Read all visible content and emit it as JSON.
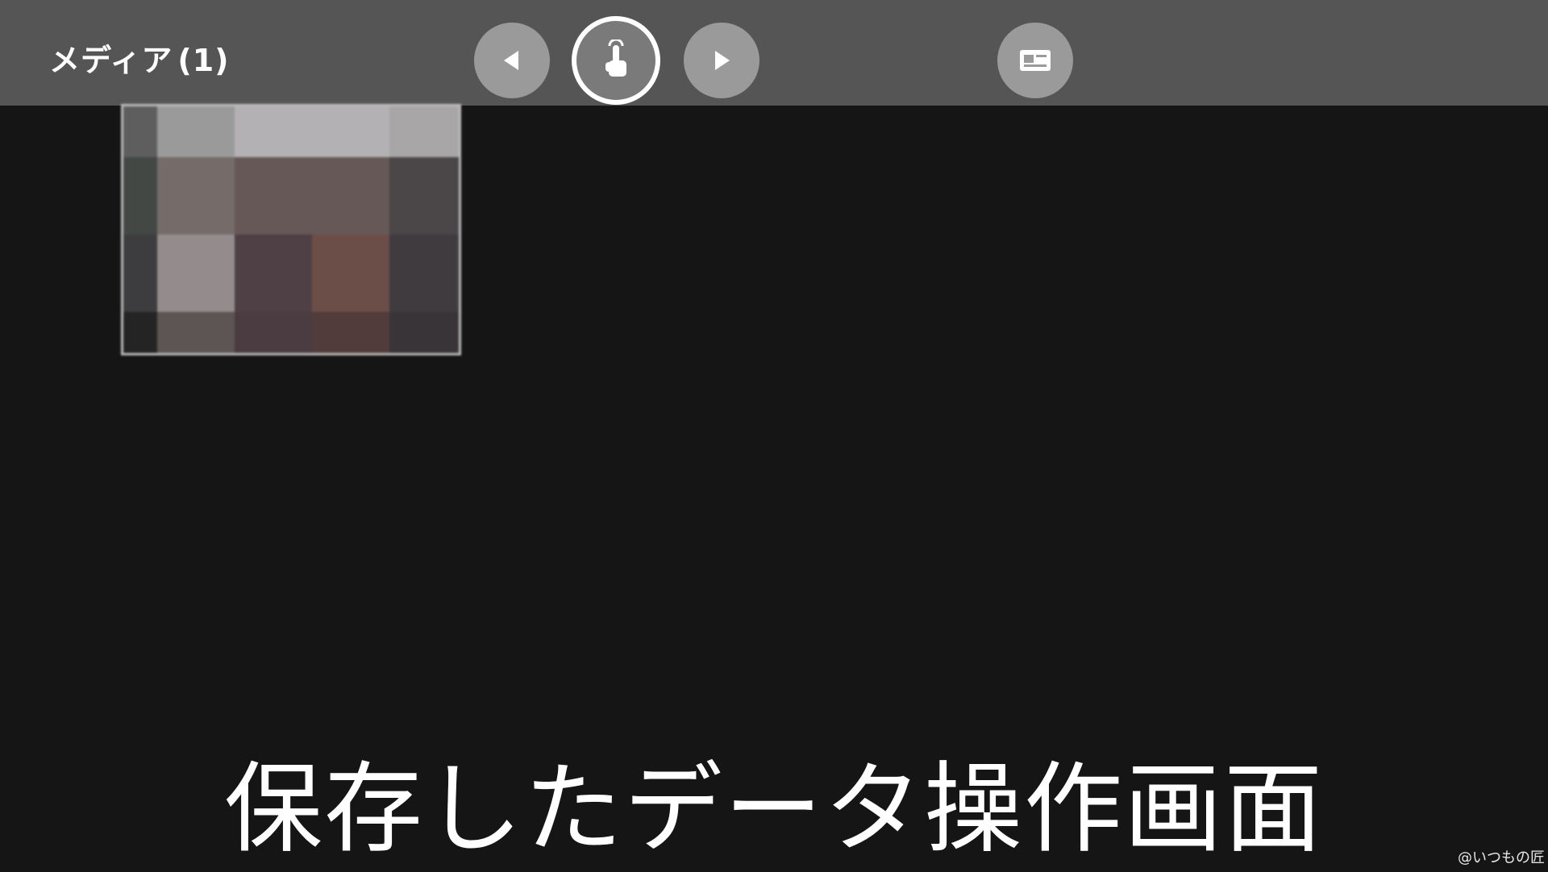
{
  "header": {
    "title": "メディア",
    "count": "(1)"
  },
  "controls": {
    "prev_icon": "triangle-left-icon",
    "select_icon": "hand-pointer-icon",
    "next_icon": "triangle-right-icon",
    "view_icon": "card-view-icon"
  },
  "media": {
    "items": [
      {
        "kind": "pixelated-thumbnail"
      }
    ]
  },
  "caption": {
    "text": "保存したデータ操作画面"
  },
  "watermark": {
    "text": "@いつもの匠"
  },
  "colors": {
    "topbar": "#555555",
    "background": "#151515",
    "button": "#9a9a9a",
    "selected_ring": "#ffffff"
  }
}
